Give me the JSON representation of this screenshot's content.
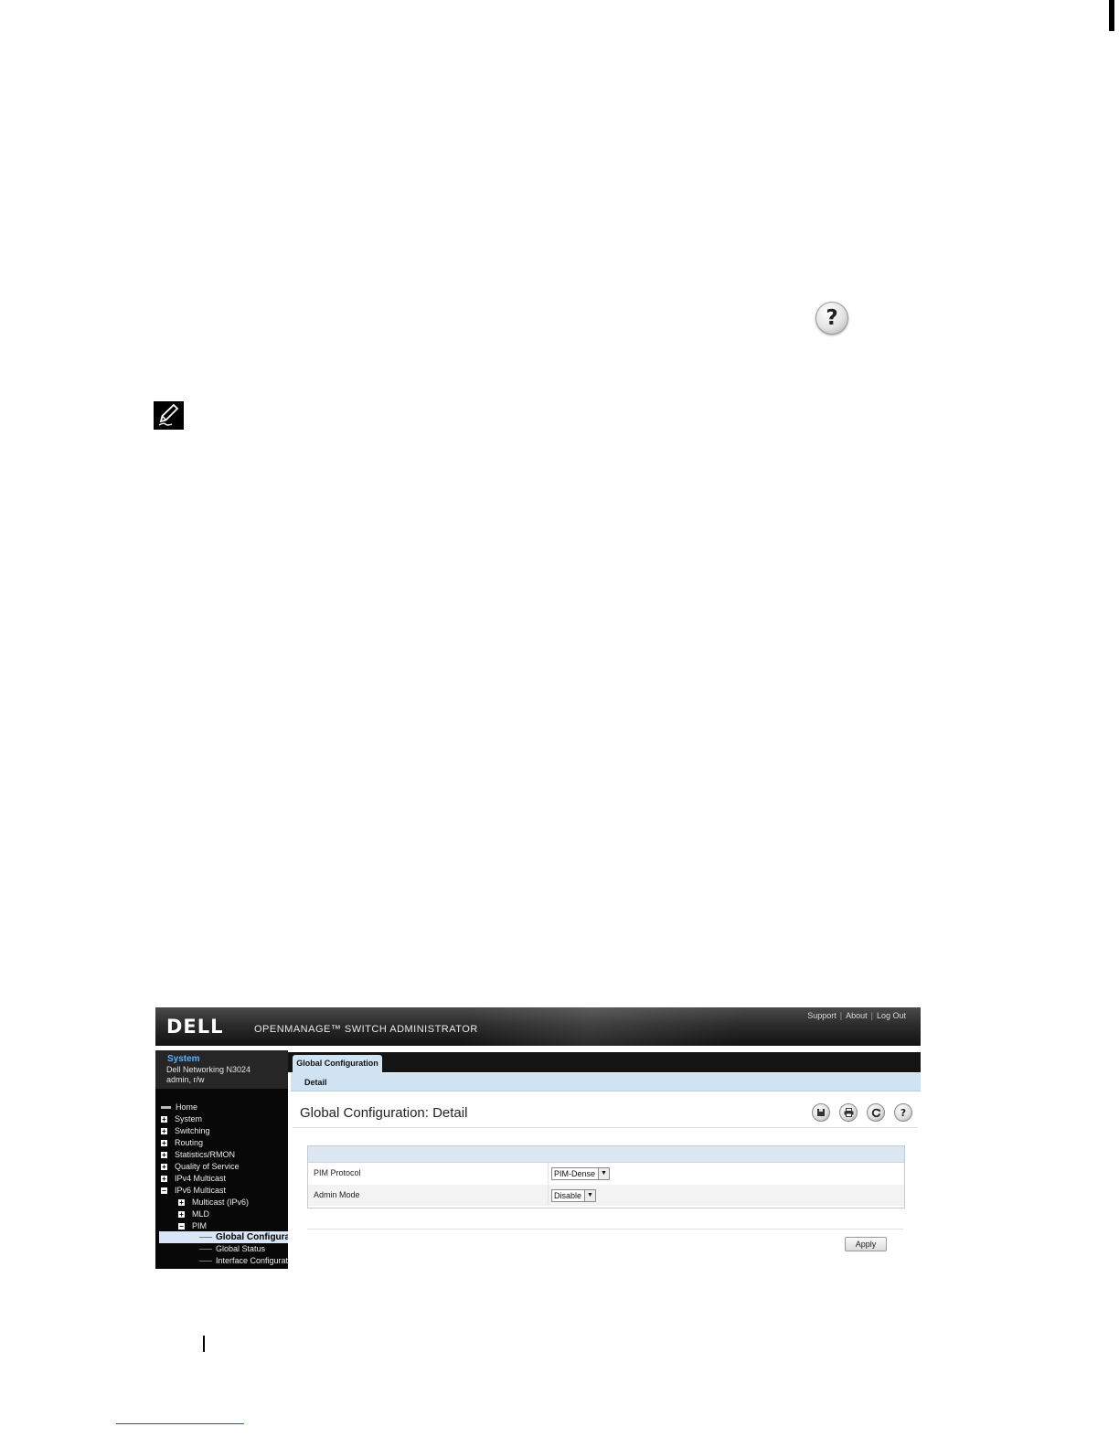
{
  "screenshot": {
    "banner": {
      "logo": "DELL",
      "app_title": "OPENMANAGE™ SWITCH ADMINISTRATOR",
      "links": [
        "Support",
        "About",
        "Log Out"
      ],
      "link_separator": "|"
    },
    "system": {
      "title": "System",
      "model": "Dell Networking N3024",
      "user": "admin, r/w"
    },
    "nav": [
      {
        "label": "Home",
        "marker": "dash"
      },
      {
        "label": "System",
        "marker": "+"
      },
      {
        "label": "Switching",
        "marker": "+"
      },
      {
        "label": "Routing",
        "marker": "+"
      },
      {
        "label": "Statistics/RMON",
        "marker": "+"
      },
      {
        "label": "Quality of Service",
        "marker": "+"
      },
      {
        "label": "IPv4 Multicast",
        "marker": "+"
      },
      {
        "label": "IPv6 Multicast",
        "marker": "−"
      },
      {
        "label": "Multicast (IPv6)",
        "marker": "+"
      },
      {
        "label": "MLD",
        "marker": "+"
      },
      {
        "label": "PIM",
        "marker": "−"
      },
      {
        "label": "Global Configuration",
        "marker": "tree",
        "selected": true
      },
      {
        "label": "Global Status",
        "marker": "tree"
      },
      {
        "label": "Interface Configuration",
        "marker": "tree"
      }
    ],
    "tab": "Global Configuration",
    "subtab": "Detail",
    "heading": "Global Configuration: Detail",
    "toolbar_icons": [
      "save-icon",
      "print-icon",
      "refresh-icon",
      "help-icon"
    ],
    "form": {
      "rows": [
        {
          "label": "PIM Protocol",
          "value": "PIM-Dense"
        },
        {
          "label": "Admin Mode",
          "value": "Disable"
        }
      ]
    },
    "apply_label": "Apply"
  },
  "icons": {
    "large_help": "help-icon",
    "note": "note-pencil-icon"
  }
}
